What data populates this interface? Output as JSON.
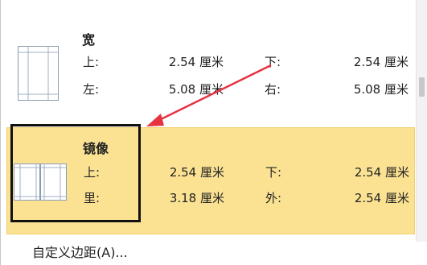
{
  "margins_gallery": {
    "presets": [
      {
        "title": "宽",
        "rows": [
          {
            "label1": "上:",
            "value1": "2.54 厘米",
            "label2": "下:",
            "value2": "2.54 厘米"
          },
          {
            "label1": "左:",
            "value1": "5.08 厘米",
            "label2": "右:",
            "value2": "5.08 厘米"
          }
        ]
      },
      {
        "title": "镜像",
        "selected": true,
        "rows": [
          {
            "label1": "上:",
            "value1": "2.54 厘米",
            "label2": "下:",
            "value2": "2.54 厘米"
          },
          {
            "label1": "里:",
            "value1": "3.18 厘米",
            "label2": "外:",
            "value2": "2.54 厘米"
          }
        ]
      }
    ],
    "custom_margins_label": "自定义边距(A)...",
    "custom_margins_access_key": "A"
  },
  "colors": {
    "selection_fill": "#fbe293",
    "annotation_arrow": "#e63342"
  },
  "icons": {
    "wide_preset": "wide-margins-page-icon",
    "mirror_preset": "mirrored-margins-pages-icon"
  }
}
